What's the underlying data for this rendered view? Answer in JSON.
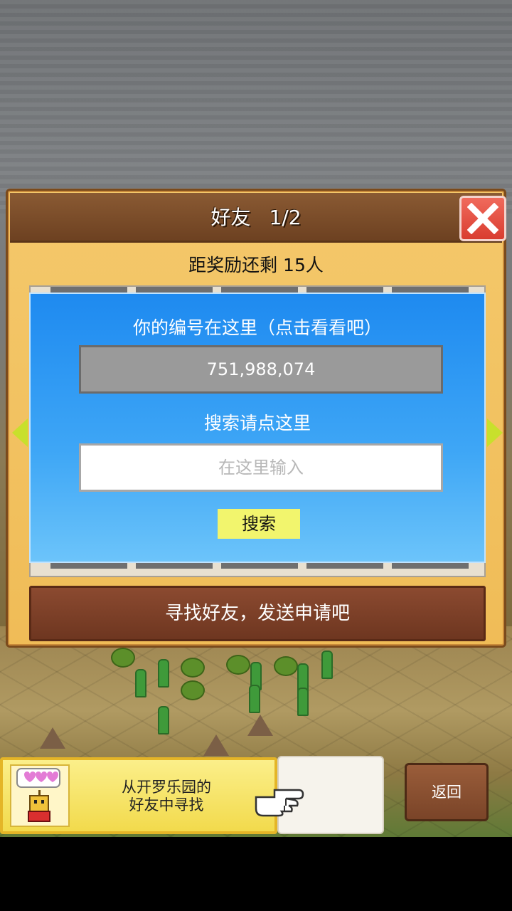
{
  "dialog": {
    "title": "好友",
    "page": "1/2",
    "reward_text": "距奖励还剩 15人",
    "id_caption": "你的编号在这里（点击看看吧）",
    "player_id": "751,988,074",
    "search_caption": "搜索请点这里",
    "search_placeholder": "在这里输入",
    "search_button": "搜索",
    "find_friends_button": "寻找好友，发送申请吧"
  },
  "bottom_bar": {
    "kairo_line1": "从开罗乐园的",
    "kairo_line2": "好友中寻找",
    "back_button": "返回"
  },
  "colors": {
    "dialog_bg": "#f0bc57",
    "header_bg": "#6d4121",
    "close_red": "#d93d30",
    "panel_blue": "#1e8af0",
    "search_yellow": "#f2f56d",
    "find_button": "#7a3c24"
  },
  "icons": [
    "close-icon",
    "arrow-left-icon",
    "arrow-right-icon",
    "kairo-bot-icon",
    "pointing-hand-icon"
  ]
}
